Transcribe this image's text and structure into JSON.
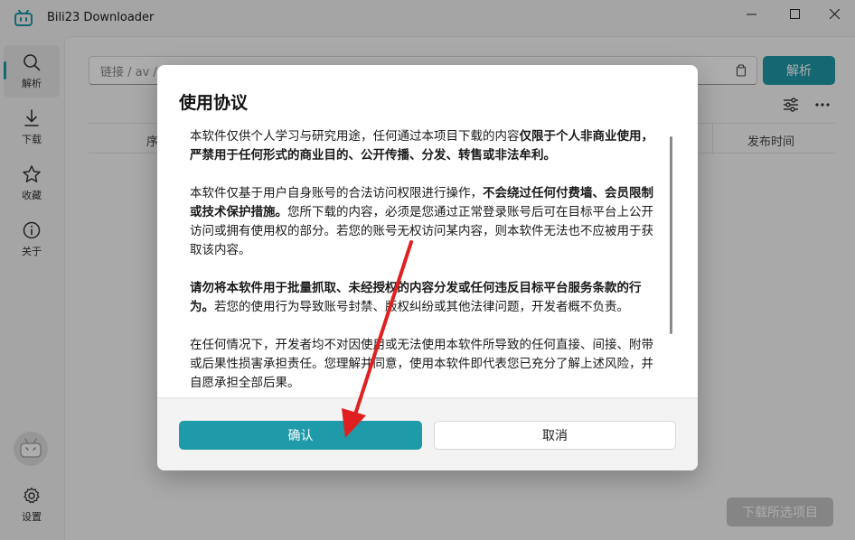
{
  "window": {
    "title": "Bili23 Downloader",
    "minimize_icon": "minimize-icon",
    "maximize_icon": "maximize-icon",
    "close_icon": "close-icon"
  },
  "sidebar": {
    "items": [
      {
        "icon": "search-icon",
        "label": "解析",
        "active": true
      },
      {
        "icon": "download-icon",
        "label": "下载",
        "active": false
      },
      {
        "icon": "star-icon",
        "label": "收藏",
        "active": false
      },
      {
        "icon": "info-icon",
        "label": "关于",
        "active": false
      }
    ],
    "settings_label": "设置"
  },
  "main": {
    "url_placeholder": "链接 / av /",
    "parse_label": "解析",
    "table": {
      "col_index": "序",
      "col_publish": "发布时间"
    },
    "download_selected_label": "下载所选项目"
  },
  "dialog": {
    "title": "使用协议",
    "paragraphs": [
      {
        "segments": [
          {
            "text": "本软件仅供个人学习与研究用途，任何通过本项目下载的内容",
            "bold": false
          },
          {
            "text": "仅限于个人非商业使用，严禁用于任何形式的商业目的、公开传播、分发、转售或非法牟利。",
            "bold": true
          }
        ]
      },
      {
        "segments": [
          {
            "text": "本软件仅基于用户自身账号的合法访问权限进行操作，",
            "bold": false
          },
          {
            "text": "不会绕过任何付费墙、会员限制或技术保护措施。",
            "bold": true
          },
          {
            "text": "您所下载的内容，必须是您通过正常登录账号后可在目标平台上公开访问或拥有使用权的部分。若您的账号无权访问某内容，则本软件无法也不应被用于获取该内容。",
            "bold": false
          }
        ]
      },
      {
        "segments": [
          {
            "text": "请勿将本软件用于批量抓取、未经授权的内容分发或任何违反目标平台服务条款的行为。",
            "bold": true
          },
          {
            "text": "若您的使用行为导致账号封禁、版权纠纷或其他法律问题，开发者概不负责。",
            "bold": false
          }
        ]
      },
      {
        "segments": [
          {
            "text": "在任何情况下，开发者均不对因使用或无法使用本软件所导致的任何直接、间接、附带或后果性损害承担责任。您理解并同意，使用本软件即代表您已充分了解上述风险，并自愿承担全部后果。",
            "bold": false
          }
        ]
      }
    ],
    "confirm_label": "确认",
    "cancel_label": "取消"
  },
  "colors": {
    "accent": "#1f9aa8",
    "annotation_arrow": "#e02020"
  }
}
